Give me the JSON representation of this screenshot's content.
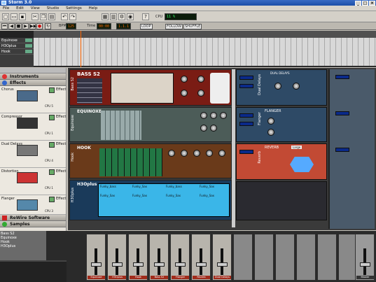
{
  "window": {
    "title": "Storm 3.0"
  },
  "menu": [
    "File",
    "Edit",
    "View",
    "Studio",
    "Settings",
    "Help"
  ],
  "toolbar": {
    "cpu_label": "CPU",
    "cpu_value": "11 %"
  },
  "transport": {
    "bpm_label": "BPM",
    "bpm_value": "125",
    "time_label": "Time",
    "time_value": "00:00",
    "bar_value": "1.1.1",
    "loop_label": "LOOP",
    "follow_label": "FOLLOW",
    "shuffle_label": "SHUFFLE"
  },
  "sequencer": {
    "tracks": [
      "Equinoxe",
      "H3Oplus",
      "Hook"
    ]
  },
  "sidebar": {
    "sections": {
      "instruments": "Instruments",
      "effects": "Effects",
      "rewire": "ReWire Software",
      "samples": "Samples"
    },
    "effects": [
      {
        "name": "Chorus",
        "type": "Effect",
        "cpu": "CPU 5"
      },
      {
        "name": "Compressor",
        "type": "Effect",
        "cpu": "CPU 1"
      },
      {
        "name": "Dual Delays",
        "type": "Effect",
        "cpu": "CPU 4"
      },
      {
        "name": "Distortion",
        "type": "Effect",
        "cpu": "CPU 1"
      },
      {
        "name": "Flanger",
        "type": "Effect",
        "cpu": "CPU 3"
      }
    ]
  },
  "rack": {
    "instruments": [
      {
        "name": "BASS S2",
        "side": "Bass S2"
      },
      {
        "name": "EQUINOXE",
        "side": "Equinoxe"
      },
      {
        "name": "HOOK",
        "side": "Hook"
      },
      {
        "name": "H3Oplus",
        "side": "H3Oplus"
      }
    ],
    "effects": [
      {
        "name": "DUAL DELAYS",
        "side": "Dual Delays"
      },
      {
        "name": "FLANGER",
        "side": "Flanger"
      },
      {
        "name": "REVERB",
        "side": "Reverb",
        "preset": "Large"
      }
    ],
    "h3o_cells": [
      "Funky_bass",
      "Funky_Sax",
      "Funky_bass",
      "Funky_Sax",
      "Funky_Sax",
      "Funky_Sax",
      "Funky_Sax",
      "Funky_Sax"
    ]
  },
  "mixer": {
    "channels": [
      "Equinoxe",
      "H3Oplus",
      "Hook",
      "Bass S2",
      "Flanger",
      "Reverb",
      "Dual Delays"
    ],
    "master": "Master"
  },
  "minibrowser": {
    "items": [
      "Bass S2",
      "Equinoxe",
      "Hook",
      "H3Oplus"
    ]
  }
}
